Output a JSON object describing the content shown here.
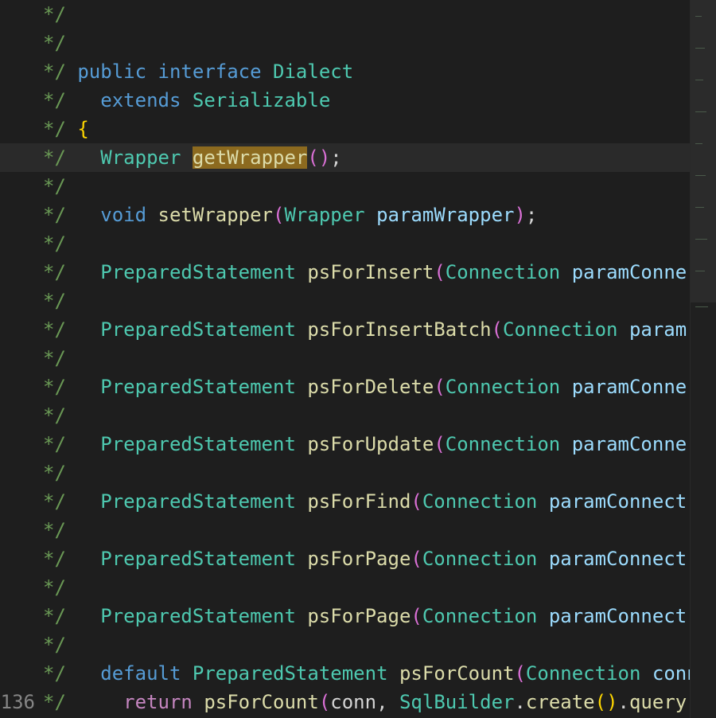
{
  "editor": {
    "current_line_number": "136",
    "highlighted_word": "getWrapper"
  },
  "code": {
    "comment": "*/",
    "l3": {
      "public": "public",
      "interface": "interface",
      "name": "Dialect"
    },
    "l4": {
      "extends": "extends",
      "type": "Serializable"
    },
    "l5": {
      "brace": "{"
    },
    "l6": {
      "type": "Wrapper",
      "method": "getWrapper",
      "open": "(",
      "close": ")",
      "semi": ";"
    },
    "l8": {
      "void": "void",
      "method": "setWrapper",
      "open": "(",
      "ptype": "Wrapper",
      "param": "paramWrapper",
      "close": ")",
      "semi": ";"
    },
    "ps_type": "PreparedStatement",
    "conn_type": "Connection",
    "l10": {
      "method": "psForInsert",
      "param": "paramConne"
    },
    "l12": {
      "method": "psForInsertBatch",
      "param": "param("
    },
    "l14": {
      "method": "psForDelete",
      "param": "paramConne"
    },
    "l16": {
      "method": "psForUpdate",
      "param": "paramConne"
    },
    "l18": {
      "method": "psForFind",
      "param": "paramConnect"
    },
    "l20": {
      "method": "psForPage",
      "param": "paramConnect"
    },
    "l22": {
      "method": "psForPage",
      "param": "paramConnect"
    },
    "l24": {
      "default": "default",
      "method": "psForCount",
      "param": "conn"
    },
    "l25": {
      "return": "return",
      "method": "psForCount",
      "open": "(",
      "arg": "conn, ",
      "cls": "SqlBuilder",
      "dot1": ".",
      "create": "create",
      "paren": "()",
      "dot2": ".",
      "query": "query"
    }
  }
}
